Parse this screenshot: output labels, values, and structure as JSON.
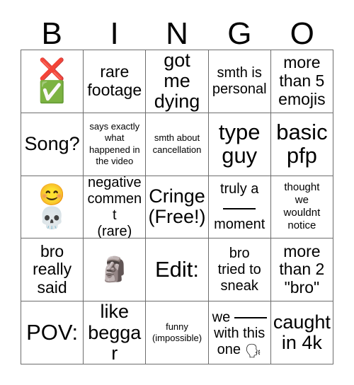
{
  "card": {
    "title": "BINGO",
    "header_letters": [
      "B",
      "I",
      "N",
      "G",
      "O"
    ],
    "rows": 5,
    "columns": 5,
    "grid_line_color": "#6d6d6d",
    "background_color": "#ffffff",
    "text_color": "#000000"
  },
  "cells": [
    {
      "id": "b1",
      "column": "B",
      "row": 1,
      "type": "emoji-stack",
      "text": "",
      "emojis": [
        "❌",
        "✅"
      ],
      "emoji_names": [
        "cross-mark-emoji",
        "check-mark-button-emoji"
      ],
      "size": "emoji"
    },
    {
      "id": "i1",
      "column": "I",
      "row": 1,
      "type": "text",
      "text": "rare\nfootage",
      "size": "fs-lg"
    },
    {
      "id": "n1",
      "column": "N",
      "row": 1,
      "type": "text",
      "text": "got me\ndying",
      "size": "fs-xl"
    },
    {
      "id": "g1",
      "column": "G",
      "row": 1,
      "type": "text",
      "text": "smth is\npersonal",
      "size": "fs-md"
    },
    {
      "id": "o1",
      "column": "O",
      "row": 1,
      "type": "text",
      "text": "more\nthan 5\nemojis",
      "size": "fs-lg"
    },
    {
      "id": "b2",
      "column": "B",
      "row": 2,
      "type": "text",
      "text": "Song?",
      "size": "fs-xl"
    },
    {
      "id": "i2",
      "column": "I",
      "row": 2,
      "type": "text",
      "text": "says exactly\nwhat\nhappened in\nthe video",
      "size": "fs-xs"
    },
    {
      "id": "n2",
      "column": "N",
      "row": 2,
      "type": "text",
      "text": "smth about\ncancellation",
      "size": "fs-xs"
    },
    {
      "id": "g2",
      "column": "G",
      "row": 2,
      "type": "text",
      "text": "type\nguy",
      "size": "fs-xxl"
    },
    {
      "id": "o2",
      "column": "O",
      "row": 2,
      "type": "text",
      "text": "basic\npfp",
      "size": "fs-xxl"
    },
    {
      "id": "b3",
      "column": "B",
      "row": 3,
      "type": "emoji-stack",
      "text": "",
      "emojis": [
        "😊",
        "💀"
      ],
      "emoji_names": [
        "smiling-face-with-smiling-eyes-emoji",
        "skull-emoji"
      ],
      "size": "emoji"
    },
    {
      "id": "i3",
      "column": "I",
      "row": 3,
      "type": "text",
      "text": "negative\ncomment\n(rare)",
      "size": "fs-md"
    },
    {
      "id": "n3",
      "column": "N",
      "row": 3,
      "type": "text",
      "text": "Cringe\n(Free!)",
      "size": "fs-xl",
      "free_space": true
    },
    {
      "id": "g3",
      "column": "G",
      "row": 3,
      "type": "blank-fill",
      "text_before": "truly a",
      "text_after": "moment",
      "text": "truly a ___ moment",
      "size": "fs-md"
    },
    {
      "id": "o3",
      "column": "O",
      "row": 3,
      "type": "text",
      "text": "thought\nwe\nwouldnt\nnotice",
      "size": "fs-sm"
    },
    {
      "id": "b4",
      "column": "B",
      "row": 4,
      "type": "text",
      "text": "bro\nreally\nsaid",
      "size": "fs-lg"
    },
    {
      "id": "i4",
      "column": "I",
      "row": 4,
      "type": "emoji-single",
      "text": "",
      "emojis": [
        "🗿"
      ],
      "emoji_names": [
        "moai-emoji"
      ],
      "size": "emoji"
    },
    {
      "id": "n4",
      "column": "N",
      "row": 4,
      "type": "text",
      "text": "Edit:",
      "size": "fs-xxl"
    },
    {
      "id": "g4",
      "column": "G",
      "row": 4,
      "type": "text",
      "text": "bro\ntried to\nsneak",
      "size": "fs-md"
    },
    {
      "id": "o4",
      "column": "O",
      "row": 4,
      "type": "text",
      "text": "more\nthan 2\n\"bro\"",
      "size": "fs-lg"
    },
    {
      "id": "b5",
      "column": "B",
      "row": 5,
      "type": "text",
      "text": "POV:",
      "size": "fs-xxl"
    },
    {
      "id": "i5",
      "column": "I",
      "row": 5,
      "type": "text",
      "text": "like\nbeggar",
      "size": "fs-xl"
    },
    {
      "id": "n5",
      "column": "N",
      "row": 5,
      "type": "text",
      "text": "funny\n(impossible)",
      "size": "fs-xs"
    },
    {
      "id": "g5",
      "column": "G",
      "row": 5,
      "type": "blank-emoji",
      "text_before": "we",
      "text_after": "with this\none",
      "text": "we ___ with this one 🗣",
      "emojis": [
        "🗣"
      ],
      "emoji_names": [
        "speaking-head-emoji"
      ],
      "size": "fs-md"
    },
    {
      "id": "o5",
      "column": "O",
      "row": 5,
      "type": "text",
      "text": "caught\nin 4k",
      "size": "fs-xl"
    }
  ]
}
